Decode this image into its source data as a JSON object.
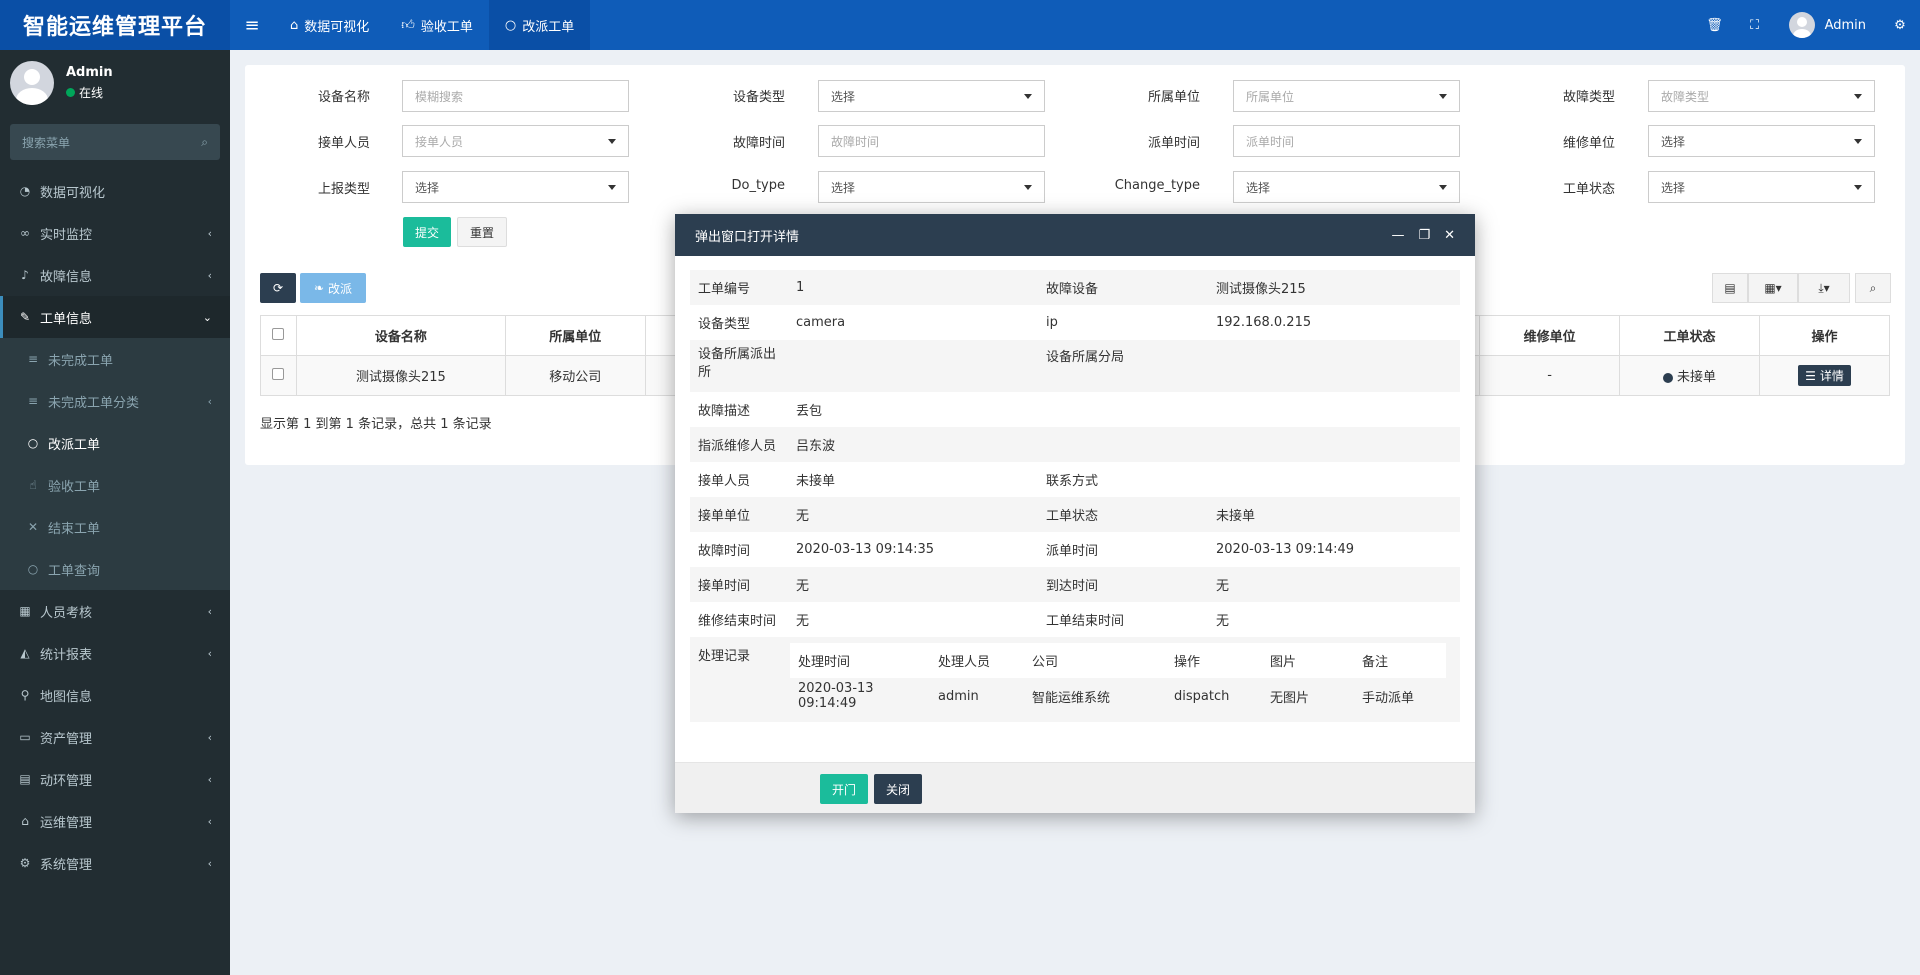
{
  "header": {
    "brand": "智能运维管理平台",
    "tabs": [
      {
        "icon": "home-icon",
        "label": "数据可视化"
      },
      {
        "icon": "thumbs-up-icon",
        "label": "验收工单"
      },
      {
        "icon": "circle-icon",
        "label": "改派工单"
      }
    ],
    "user": "Admin"
  },
  "sidebar": {
    "user_name": "Admin",
    "user_status": "在线",
    "search_placeholder": "搜索菜单",
    "items": [
      {
        "label": "数据可视化"
      },
      {
        "label": "实时监控"
      },
      {
        "label": "故障信息"
      },
      {
        "label": "工单信息"
      },
      {
        "label": "人员考核"
      },
      {
        "label": "统计报表"
      },
      {
        "label": "地图信息"
      },
      {
        "label": "资产管理"
      },
      {
        "label": "动环管理"
      },
      {
        "label": "运维管理"
      },
      {
        "label": "系统管理"
      }
    ],
    "subitems": [
      {
        "label": "未完成工单"
      },
      {
        "label": "未完成工单分类"
      },
      {
        "label": "改派工单"
      },
      {
        "label": "验收工单"
      },
      {
        "label": "结束工单"
      },
      {
        "label": "工单查询"
      }
    ]
  },
  "filters": {
    "device_name": {
      "label": "设备名称",
      "placeholder": "模糊搜索"
    },
    "device_type": {
      "label": "设备类型",
      "value": "选择"
    },
    "unit": {
      "label": "所属单位",
      "placeholder": "所属单位"
    },
    "fault_type": {
      "label": "故障类型",
      "placeholder": "故障类型"
    },
    "receiver": {
      "label": "接单人员",
      "placeholder": "接单人员"
    },
    "fault_time": {
      "label": "故障时间",
      "placeholder": "故障时间"
    },
    "dispatch_time": {
      "label": "派单时间",
      "placeholder": "派单时间"
    },
    "repair_unit": {
      "label": "维修单位",
      "value": "选择"
    },
    "report_type": {
      "label": "上报类型",
      "value": "选择"
    },
    "do_type": {
      "label": "Do_type",
      "value": "选择"
    },
    "change_type": {
      "label": "Change_type",
      "value": "选择"
    },
    "order_status": {
      "label": "工单状态",
      "value": "选择"
    },
    "submit": "提交",
    "reset": "重置"
  },
  "toolbar": {
    "reassign": "改派"
  },
  "table": {
    "headers": {
      "device_name": "设备名称",
      "unit": "所属单位",
      "repair_unit": "维修单位",
      "status": "工单状态",
      "action": "操作"
    },
    "rows": [
      {
        "device_name": "测试摄像头215",
        "unit": "移动公司",
        "repair_unit": "-",
        "status": "未接单",
        "action": "详情"
      }
    ],
    "footer": "显示第 1 到第 1 条记录，总共 1 条记录"
  },
  "modal": {
    "title": "弹出窗口打开详情",
    "fields": {
      "order_no_label": "工单编号",
      "order_no": "1",
      "fault_device_label": "故障设备",
      "fault_device": "测试摄像头215",
      "device_type_label": "设备类型",
      "device_type": "camera",
      "ip_label": "ip",
      "ip": "192.168.0.215",
      "police_station_label": "设备所属派出所",
      "sub_bureau_label": "设备所属分局",
      "fault_desc_label": "故障描述",
      "fault_desc": "丢包",
      "assigned_label": "指派维修人员",
      "assigned": "吕东波",
      "receiver_label": "接单人员",
      "receiver": "未接单",
      "contact_label": "联系方式",
      "receive_unit_label": "接单单位",
      "receive_unit": "无",
      "status_label": "工单状态",
      "status": "未接单",
      "fault_time_label": "故障时间",
      "fault_time": "2020-03-13 09:14:35",
      "dispatch_time_label": "派单时间",
      "dispatch_time": "2020-03-13 09:14:49",
      "receive_time_label": "接单时间",
      "receive_time": "无",
      "arrive_time_label": "到达时间",
      "arrive_time": "无",
      "repair_end_label": "维修结束时间",
      "repair_end": "无",
      "order_end_label": "工单结束时间",
      "order_end": "无",
      "records_label": "处理记录"
    },
    "records": {
      "headers": {
        "time": "处理时间",
        "person": "处理人员",
        "company": "公司",
        "op": "操作",
        "img": "图片",
        "note": "备注"
      },
      "rows": [
        {
          "time": "2020-03-13 09:14:49",
          "person": "admin",
          "company": "智能运维系统",
          "op": "dispatch",
          "img": "无图片",
          "note": "手动派单"
        }
      ]
    },
    "open_btn": "开门",
    "close_btn": "关闭"
  }
}
